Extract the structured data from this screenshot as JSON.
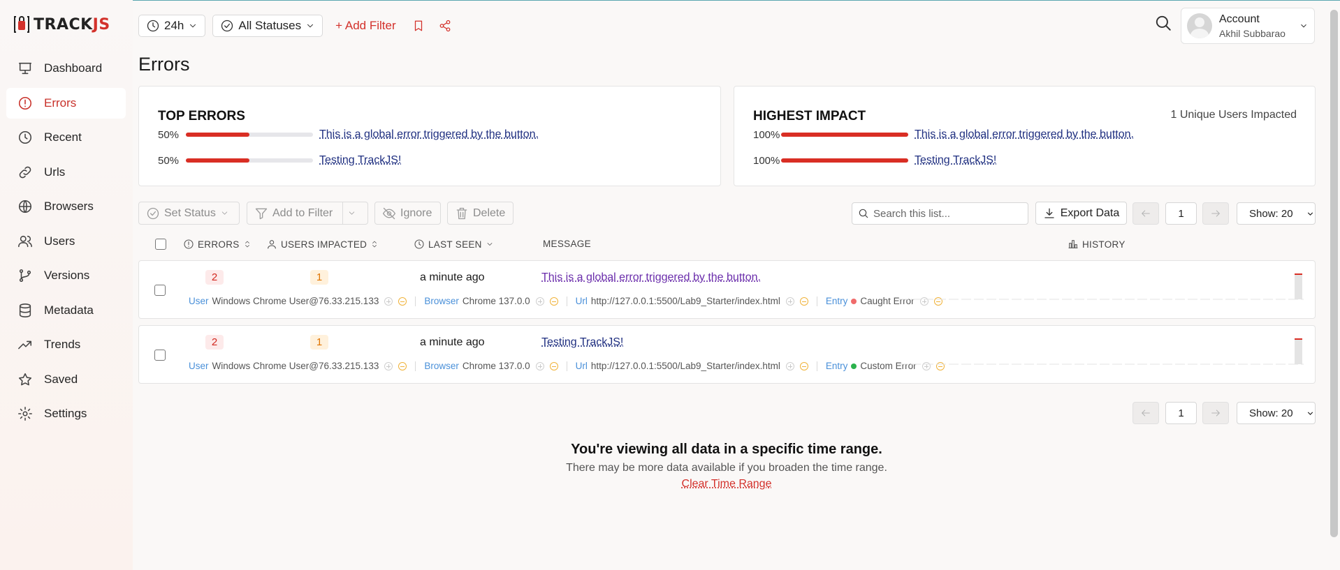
{
  "app": {
    "logo_text": "TRACK",
    "logo_accent": "JS",
    "brand_color": "#d3312b"
  },
  "sidebar": {
    "items": [
      {
        "label": "Dashboard",
        "icon": "presentation-icon"
      },
      {
        "label": "Errors",
        "icon": "alert-circle-icon",
        "active": true
      },
      {
        "label": "Recent",
        "icon": "clock-icon"
      },
      {
        "label": "Urls",
        "icon": "link-icon"
      },
      {
        "label": "Browsers",
        "icon": "globe-icon"
      },
      {
        "label": "Users",
        "icon": "users-icon"
      },
      {
        "label": "Versions",
        "icon": "git-branch-icon"
      },
      {
        "label": "Metadata",
        "icon": "database-icon"
      },
      {
        "label": "Trends",
        "icon": "trend-up-icon"
      },
      {
        "label": "Saved",
        "icon": "star-icon"
      },
      {
        "label": "Settings",
        "icon": "gear-icon"
      }
    ]
  },
  "topbar": {
    "time_range": "24h",
    "status_filter": "All Statuses",
    "add_filter": "+ Add Filter"
  },
  "account": {
    "title": "Account",
    "name": "Akhil Subbarao"
  },
  "page": {
    "title": "Errors"
  },
  "top_errors": {
    "title": "TOP ERRORS",
    "items": [
      {
        "pct_label": "50%",
        "pct": 50,
        "message": "This is a global error triggered by the button."
      },
      {
        "pct_label": "50%",
        "pct": 50,
        "message": "Testing TrackJS!"
      }
    ]
  },
  "highest_impact": {
    "title": "HIGHEST IMPACT",
    "note": "1 Unique Users Impacted",
    "items": [
      {
        "pct_label": "100%",
        "pct": 100,
        "message": "This is a global error triggered by the button."
      },
      {
        "pct_label": "100%",
        "pct": 100,
        "message": "Testing TrackJS!"
      }
    ]
  },
  "toolbar": {
    "set_status": "Set Status",
    "add_to_filter": "Add to Filter",
    "ignore": "Ignore",
    "delete": "Delete",
    "search_placeholder": "Search this list...",
    "export": "Export Data",
    "page": "1",
    "show": "Show: 20"
  },
  "table": {
    "headers": {
      "errors": "ERRORS",
      "users": "USERS IMPACTED",
      "last_seen": "LAST SEEN",
      "message": "MESSAGE",
      "history": "HISTORY"
    },
    "rows": [
      {
        "errors": "2",
        "users": "1",
        "last_seen": "a minute ago",
        "message": "This is a global error triggered by the button.",
        "user_key": "User",
        "user_val": "Windows Chrome User@76.33.215.133",
        "browser_key": "Browser",
        "browser_val": "Chrome 137.0.0",
        "url_key": "Url",
        "url_val": "http://127.0.0.1:5500/Lab9_Starter/index.html",
        "entry_key": "Entry",
        "entry_val": "Caught Error",
        "entry_color": "#f06b6b"
      },
      {
        "errors": "2",
        "users": "1",
        "last_seen": "a minute ago",
        "message": "Testing TrackJS!",
        "user_key": "User",
        "user_val": "Windows Chrome User@76.33.215.133",
        "browser_key": "Browser",
        "browser_val": "Chrome 137.0.0",
        "url_key": "Url",
        "url_val": "http://127.0.0.1:5500/Lab9_Starter/index.html",
        "entry_key": "Entry",
        "entry_val": "Custom Error",
        "entry_color": "#2bb24c"
      }
    ]
  },
  "footer": {
    "title": "You're viewing all data in a specific time range.",
    "subtitle": "There may be more data available if you broaden the time range.",
    "link": "Clear Time Range"
  }
}
